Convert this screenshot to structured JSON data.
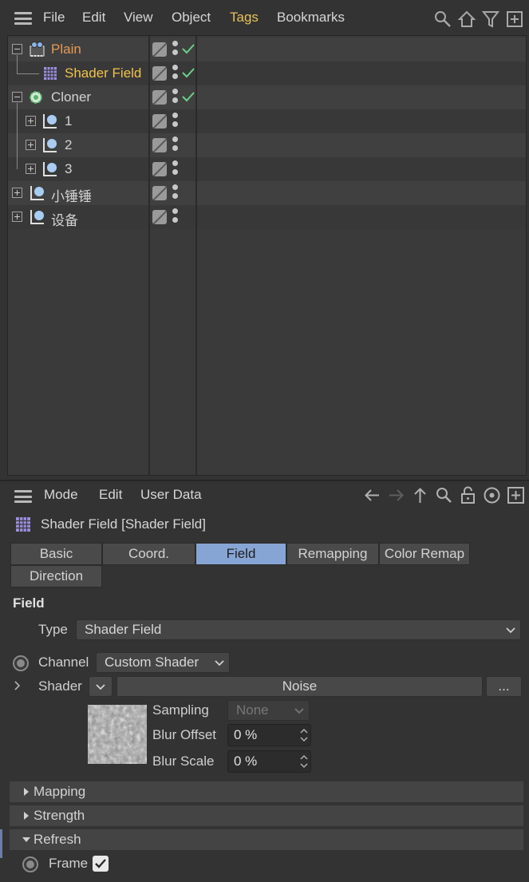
{
  "object_manager": {
    "menu": [
      "File",
      "Edit",
      "View",
      "Object",
      "Tags",
      "Bookmarks"
    ],
    "objects": [
      {
        "name": "Plain",
        "icon": "camera-object-icon",
        "color": "#e49a52",
        "check": true
      },
      {
        "name": "Shader Field",
        "icon": "shader-field-icon",
        "color": "#f0c24a",
        "check": true
      },
      {
        "name": "Cloner",
        "icon": "cloner-icon",
        "color": "#d2d2d2",
        "check": true
      },
      {
        "name": "1",
        "icon": "null-object-icon",
        "color": "#d2d2d2",
        "check": false
      },
      {
        "name": "2",
        "icon": "null-object-icon",
        "color": "#d2d2d2",
        "check": false
      },
      {
        "name": "3",
        "icon": "null-object-icon",
        "color": "#d2d2d2",
        "check": false
      },
      {
        "name": "小锤锤",
        "icon": "null-object-icon",
        "color": "#d2d2d2",
        "check": false
      },
      {
        "name": "设备",
        "icon": "null-object-icon",
        "color": "#d2d2d2",
        "check": false
      }
    ]
  },
  "attribute_manager": {
    "menu": [
      "Mode",
      "Edit",
      "User Data"
    ],
    "title": "Shader Field [Shader Field]",
    "tabs": [
      "Basic",
      "Coord.",
      "Field",
      "Remapping",
      "Color Remap",
      "Direction"
    ],
    "active_tab": "Field",
    "section": "Field",
    "type_label": "Type",
    "type_value": "Shader Field",
    "channel_label": "Channel",
    "channel_value": "Custom Shader",
    "shader_label": "Shader",
    "shader_value": "Noise",
    "shader_more": "...",
    "sampling_label": "Sampling",
    "sampling_value": "None",
    "blur_offset_label": "Blur Offset",
    "blur_offset_value": "0 %",
    "blur_scale_label": "Blur Scale",
    "blur_scale_value": "0 %",
    "groups": [
      {
        "label": "Mapping",
        "open": false
      },
      {
        "label": "Strength",
        "open": false
      },
      {
        "label": "Refresh",
        "open": true
      }
    ],
    "frame_label": "Frame",
    "frame_checked": true
  }
}
